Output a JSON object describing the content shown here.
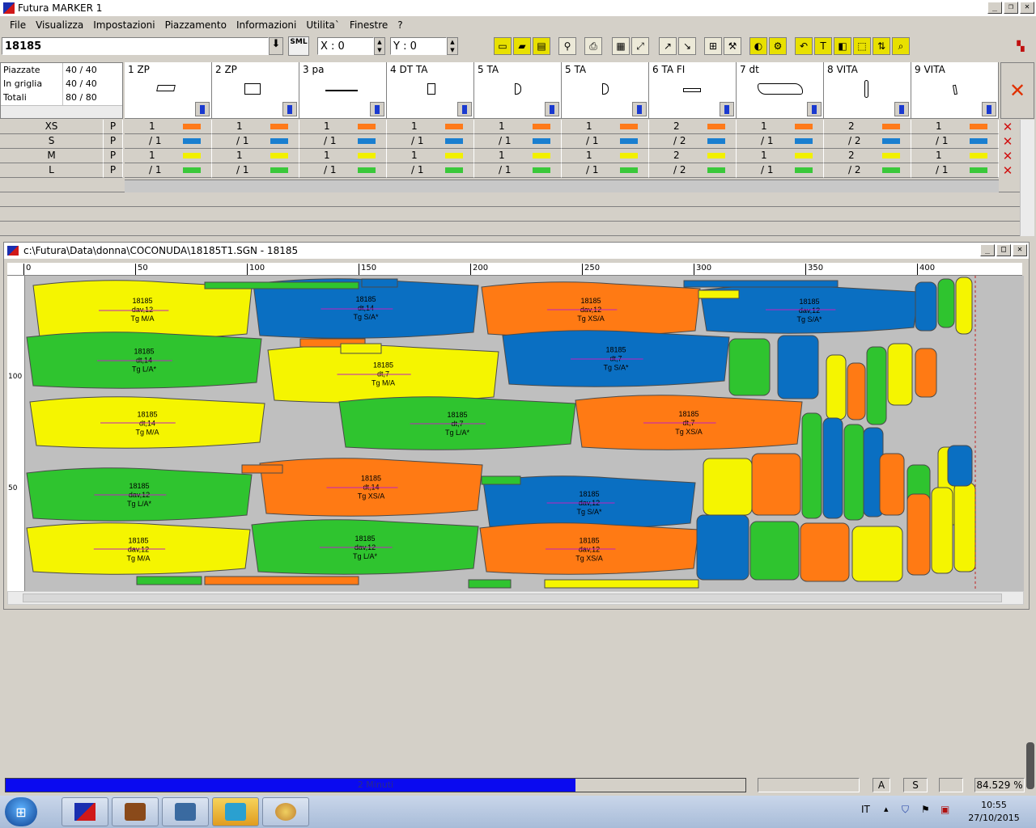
{
  "window": {
    "title": "Futura MARKER 1"
  },
  "menu": [
    "File",
    "Visualizza",
    "Impostazioni",
    "Piazzamento",
    "Informazioni",
    "Utilita`",
    "Finestre",
    "?"
  ],
  "toolbar": {
    "marker_id": "18185",
    "sml_label": "SML",
    "x_value": "X : 0",
    "y_value": "Y : 0"
  },
  "summary": {
    "rows": [
      {
        "label": "Piazzate",
        "value": "40 / 40"
      },
      {
        "label": "In griglia",
        "value": "40 / 40"
      },
      {
        "label": "Totali",
        "value": "80 / 80"
      }
    ]
  },
  "pieces": [
    "1 ZP",
    "2 ZP",
    "3 pa",
    "4 DT TA",
    "5 TA",
    "5 TA",
    "6 TA FI",
    "7 dt",
    "8 VITA",
    "9 VITA"
  ],
  "size_rows": [
    {
      "size": "XS",
      "flag": "P",
      "color": "#ff7a1a",
      "counts": [
        "1",
        "1",
        "1",
        "1",
        "1",
        "1",
        "2",
        "1",
        "2",
        "1"
      ]
    },
    {
      "size": "S",
      "flag": "P",
      "color": "#1a7fd0",
      "counts": [
        "/ 1",
        "/ 1",
        "/ 1",
        "/ 1",
        "/ 1",
        "/ 1",
        "/ 2",
        "/ 1",
        "/ 2",
        "/ 1"
      ]
    },
    {
      "size": "M",
      "flag": "P",
      "color": "#f2f000",
      "counts": [
        "1",
        "1",
        "1",
        "1",
        "1",
        "1",
        "2",
        "1",
        "2",
        "1"
      ]
    },
    {
      "size": "L",
      "flag": "P",
      "color": "#3ac83a",
      "counts": [
        "/ 1",
        "/ 1",
        "/ 1",
        "/ 1",
        "/ 1",
        "/ 1",
        "/ 2",
        "/ 1",
        "/ 2",
        "/ 1"
      ]
    }
  ],
  "inner_window": {
    "title": "c:\\Futura\\Data\\donna\\COCONUDA\\18185T1.SGN  -  18185"
  },
  "ruler": {
    "h_ticks": [
      "0",
      "50",
      "100",
      "150",
      "200",
      "250",
      "300",
      "350",
      "400"
    ],
    "v_ticks": [
      "100",
      "50"
    ]
  },
  "markers_pieces": [
    {
      "color": "#f5f500",
      "lines": [
        "18185",
        "dav,12",
        "Tg M/A"
      ]
    },
    {
      "color": "#0a6fc2",
      "lines": [
        "18185",
        "dt,14",
        "Tg S/A*"
      ]
    },
    {
      "color": "#ff7a14",
      "lines": [
        "18185",
        "dav,12",
        "Tg XS/A"
      ]
    },
    {
      "color": "#0a6fc2",
      "lines": [
        "18185",
        "dav,12",
        "Tg S/A*"
      ]
    },
    {
      "color": "#2fc42f",
      "lines": [
        "18185",
        "dt,14",
        "Tg L/A*"
      ]
    },
    {
      "color": "#f5f500",
      "lines": [
        "18185",
        "dt,7",
        "Tg M/A"
      ]
    },
    {
      "color": "#0a6fc2",
      "lines": [
        "18185",
        "dt,7",
        "Tg S/A*"
      ]
    },
    {
      "color": "#f5f500",
      "lines": [
        "18185",
        "dt,14",
        "Tg M/A"
      ]
    },
    {
      "color": "#2fc42f",
      "lines": [
        "18185",
        "dt,7",
        "Tg L/A*"
      ]
    },
    {
      "color": "#ff7a14",
      "lines": [
        "18185",
        "dt,7",
        "Tg XS/A"
      ]
    },
    {
      "color": "#2fc42f",
      "lines": [
        "18185",
        "dav,12",
        "Tg L/A*"
      ]
    },
    {
      "color": "#ff7a14",
      "lines": [
        "18185",
        "dt,14",
        "Tg XS/A"
      ]
    },
    {
      "color": "#0a6fc2",
      "lines": [
        "18185",
        "dav,12",
        "Tg S/A*"
      ]
    },
    {
      "color": "#f5f500",
      "lines": [
        "18185",
        "dav,12",
        "Tg M/A"
      ]
    },
    {
      "color": "#2fc42f",
      "lines": [
        "18185",
        "dav,12",
        "Tg L/A*"
      ]
    },
    {
      "color": "#ff7a14",
      "lines": [
        "18185",
        "dav,12",
        "Tg XS/A"
      ]
    }
  ],
  "status": {
    "progress_label": "2 Minuti",
    "progress_fraction": 0.77,
    "box_a": "A",
    "box_s": "S",
    "efficiency": "84.529 %"
  },
  "taskbar": {
    "lang": "IT",
    "time": "10:55",
    "date": "27/10/2015"
  }
}
